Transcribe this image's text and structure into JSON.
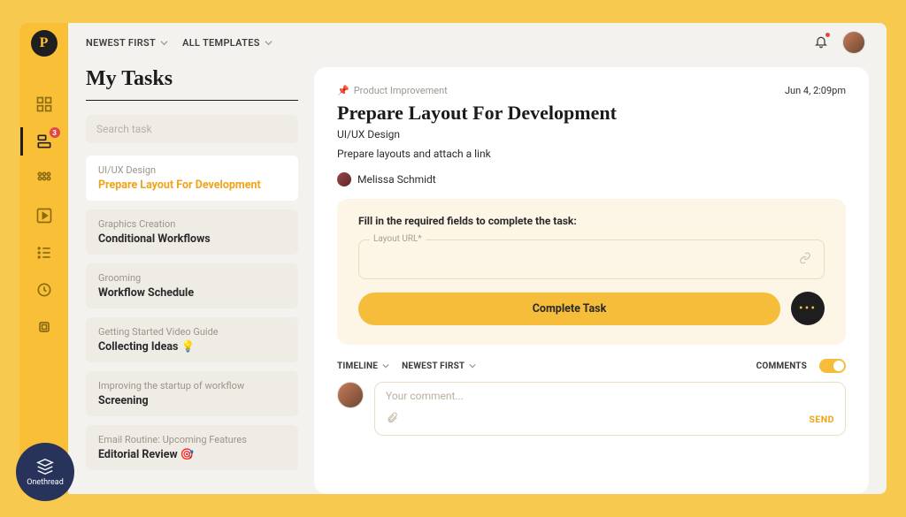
{
  "brand": {
    "logo_letter": "P"
  },
  "topbar": {
    "sort_label": "NEWEST FIRST",
    "filter_label": "ALL TEMPLATES"
  },
  "sidebar": {
    "tasks_badge": "3"
  },
  "page": {
    "title": "My Tasks",
    "search_placeholder": "Search task"
  },
  "tasks": [
    {
      "category": "UI/UX Design",
      "title": "Prepare Layout For Development",
      "active": true
    },
    {
      "category": "Graphics Creation",
      "title": "Conditional Workflows"
    },
    {
      "category": "Grooming",
      "title": "Workflow Schedule"
    },
    {
      "category": "Getting Started Video Guide",
      "title": "Collecting Ideas 💡"
    },
    {
      "category": "Improving the startup of workflow",
      "title": "Screening"
    },
    {
      "category": "Email Routine: Upcoming Features",
      "title": "Editorial Review 🎯"
    }
  ],
  "detail": {
    "category": "Product Improvement",
    "date": "Jun 4, 2:09pm",
    "title": "Prepare Layout For Development",
    "subtitle": "UI/UX Design",
    "description": "Prepare layouts and attach a link",
    "assignee": "Melissa Schmidt",
    "form": {
      "instruction": "Fill in the required fields to complete the task:",
      "url_field_label": "Layout URL*",
      "complete_label": "Complete Task"
    },
    "filters": {
      "timeline_label": "TIMELINE",
      "sort_label": "NEWEST FIRST",
      "comments_label": "COMMENTS"
    },
    "comment": {
      "placeholder": "Your comment...",
      "send_label": "SEND"
    }
  },
  "onethread_label": "Onethread"
}
